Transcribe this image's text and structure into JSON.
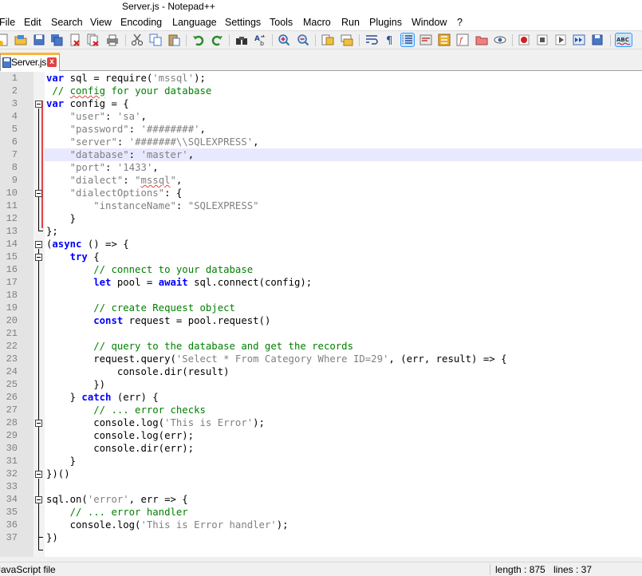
{
  "window": {
    "title": "Server.js - Notepad++"
  },
  "menu": [
    "File",
    "Edit",
    "Search",
    "View",
    "Encoding",
    "Language",
    "Settings",
    "Tools",
    "Macro",
    "Run",
    "Plugins",
    "Window",
    "?"
  ],
  "tab": {
    "label": "Server.js",
    "close": "x"
  },
  "editor": {
    "line_numbers": [
      "1",
      "2",
      "3",
      "4",
      "5",
      "6",
      "7",
      "8",
      "9",
      "10",
      "11",
      "12",
      "13",
      "14",
      "15",
      "16",
      "17",
      "18",
      "19",
      "20",
      "21",
      "22",
      "23",
      "24",
      "25",
      "26",
      "27",
      "28",
      "29",
      "30",
      "31",
      "32",
      "33",
      "34",
      "35",
      "36",
      "37"
    ],
    "current_line": 7,
    "lines": [
      [
        [
          "var",
          "kw"
        ],
        [
          " sql = require(",
          ""
        ],
        [
          "'mssql'",
          "str"
        ],
        [
          ");",
          ""
        ]
      ],
      [
        [
          " // ",
          "com"
        ],
        [
          "config",
          "com sq"
        ],
        [
          " for your database",
          "com"
        ]
      ],
      [
        [
          "var",
          "kw"
        ],
        [
          " config = {",
          ""
        ]
      ],
      [
        [
          "    ",
          ""
        ],
        [
          "\"user\"",
          "str"
        ],
        [
          ": ",
          ""
        ],
        [
          "'sa'",
          "str"
        ],
        [
          ",",
          ""
        ]
      ],
      [
        [
          "    ",
          ""
        ],
        [
          "\"password\"",
          "str"
        ],
        [
          ": ",
          ""
        ],
        [
          "'########'",
          "str"
        ],
        [
          ",",
          ""
        ]
      ],
      [
        [
          "    ",
          ""
        ],
        [
          "\"server\"",
          "str"
        ],
        [
          ": ",
          ""
        ],
        [
          "'#######\\\\SQLEXPRESS'",
          "str"
        ],
        [
          ",",
          ""
        ]
      ],
      [
        [
          "    ",
          ""
        ],
        [
          "\"database\"",
          "str"
        ],
        [
          ": ",
          ""
        ],
        [
          "'master'",
          "str"
        ],
        [
          ",",
          ""
        ]
      ],
      [
        [
          "    ",
          ""
        ],
        [
          "\"port\"",
          "str"
        ],
        [
          ": ",
          ""
        ],
        [
          "'1433'",
          "str"
        ],
        [
          ",",
          ""
        ]
      ],
      [
        [
          "    ",
          ""
        ],
        [
          "\"dialect\"",
          "str"
        ],
        [
          ": ",
          ""
        ],
        [
          "\"",
          "str"
        ],
        [
          "mssql",
          "str sq"
        ],
        [
          "\"",
          "str"
        ],
        [
          ",",
          ""
        ]
      ],
      [
        [
          "    ",
          ""
        ],
        [
          "\"dialectOptions\"",
          "str"
        ],
        [
          ": {",
          ""
        ]
      ],
      [
        [
          "        ",
          ""
        ],
        [
          "\"instanceName\"",
          "str"
        ],
        [
          ": ",
          ""
        ],
        [
          "\"SQLEXPRESS\"",
          "str"
        ]
      ],
      [
        [
          "    }",
          ""
        ]
      ],
      [
        [
          "};",
          ""
        ]
      ],
      [
        [
          "(",
          ""
        ],
        [
          "async",
          "kw"
        ],
        [
          " () => {",
          ""
        ]
      ],
      [
        [
          "    ",
          ""
        ],
        [
          "try",
          "kw"
        ],
        [
          " {",
          ""
        ]
      ],
      [
        [
          "        ",
          ""
        ],
        [
          "// connect to your database",
          "com"
        ]
      ],
      [
        [
          "        ",
          ""
        ],
        [
          "let",
          "kw"
        ],
        [
          " pool = ",
          ""
        ],
        [
          "await",
          "kw"
        ],
        [
          " sql.connect(config);",
          ""
        ]
      ],
      [
        [
          "",
          ""
        ]
      ],
      [
        [
          "        ",
          ""
        ],
        [
          "// create Request object",
          "com"
        ]
      ],
      [
        [
          "        ",
          ""
        ],
        [
          "const",
          "kw"
        ],
        [
          " request = pool.request()",
          ""
        ]
      ],
      [
        [
          "",
          ""
        ]
      ],
      [
        [
          "        ",
          ""
        ],
        [
          "// query to the database and get the records",
          "com"
        ]
      ],
      [
        [
          "        request.query(",
          ""
        ],
        [
          "'Select * From Category Where ID=29'",
          "str"
        ],
        [
          ", (err, result) => {",
          ""
        ]
      ],
      [
        [
          "            console.dir(result)",
          ""
        ]
      ],
      [
        [
          "        })",
          ""
        ]
      ],
      [
        [
          "    } ",
          ""
        ],
        [
          "catch",
          "kw"
        ],
        [
          " (err) {",
          ""
        ]
      ],
      [
        [
          "        ",
          ""
        ],
        [
          "// ... error checks",
          "com"
        ]
      ],
      [
        [
          "        console.log(",
          ""
        ],
        [
          "'This is Error'",
          "str"
        ],
        [
          ");",
          ""
        ]
      ],
      [
        [
          "        console.log(err);",
          ""
        ]
      ],
      [
        [
          "        console.dir(err);",
          ""
        ]
      ],
      [
        [
          "    }",
          ""
        ]
      ],
      [
        [
          "})()",
          ""
        ]
      ],
      [
        [
          "",
          ""
        ]
      ],
      [
        [
          "sql.on(",
          ""
        ],
        [
          "'error'",
          "str"
        ],
        [
          ", err => {",
          ""
        ]
      ],
      [
        [
          "    ",
          ""
        ],
        [
          "// ... error handler",
          "com"
        ]
      ],
      [
        [
          "    console.log(",
          ""
        ],
        [
          "'This is Error handler'",
          "str"
        ],
        [
          ");",
          ""
        ]
      ],
      [
        [
          "})",
          ""
        ]
      ]
    ]
  },
  "status": {
    "language": "JavaScript file",
    "length": "length : 875",
    "lines": "lines : 37"
  },
  "colors": {
    "keyword": "#0000ff",
    "string": "#808080",
    "comment": "#008000",
    "current_line": "#e8e8ff",
    "tab_accent": "#fab33c"
  },
  "toolbar_icons": [
    "new-icon",
    "open-icon",
    "save-icon",
    "save-all-icon",
    "close-icon",
    "close-all-icon",
    "print-icon",
    "cut-icon",
    "copy-icon",
    "paste-icon",
    "undo-icon",
    "redo-icon",
    "find-icon",
    "replace-icon",
    "zoom-in-icon",
    "zoom-out-icon",
    "sync-vertical-icon",
    "sync-horizontal-icon",
    "word-wrap-icon",
    "show-all-chars-icon",
    "indent-guide-icon",
    "udl-icon",
    "doc-map-icon",
    "function-list-icon",
    "folder-workspace-icon",
    "monitoring-icon",
    "record-macro-icon",
    "stop-record-icon",
    "play-macro-icon",
    "run-macro-multiple-icon",
    "save-macro-icon",
    "spell-check-icon"
  ]
}
